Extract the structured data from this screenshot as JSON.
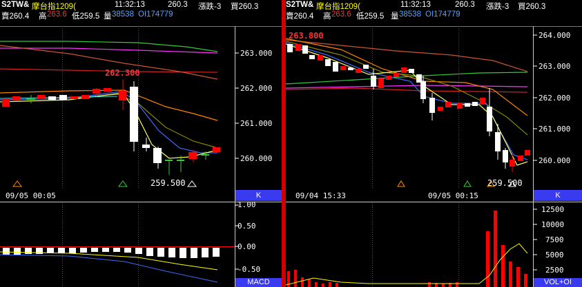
{
  "left": {
    "header": {
      "symbol": "S2TW&",
      "name": "摩台指1209(",
      "time": "11:32:13",
      "last": "260.3",
      "change": "漲跌-3",
      "bid_label": "買260.3",
      "ask": "賣260.4",
      "high_label": "高",
      "high": "263.6",
      "low": "低259.5",
      "volume_label": "量",
      "volume": "38538",
      "oi": "OI174779"
    },
    "price_axis": [
      "263.000",
      "262.000",
      "261.000",
      "260.000"
    ],
    "high_marker": "262.300",
    "low_marker": "259.500",
    "time_label": "09/05 00:05",
    "k_button": "K",
    "macd_axis": [
      "1.00",
      "0.50",
      "0.00",
      "-0.50"
    ],
    "macd_button": "MACD"
  },
  "right": {
    "header": {
      "symbol": "S2TW&",
      "name": "摩台指1209(",
      "time": "11:32:13",
      "last": "260.3",
      "change": "漲跌-3",
      "bid_label": "買260.3",
      "ask": "賣260.4",
      "high_label": "高",
      "high": "263.6",
      "low": "低259.5",
      "volume_label": "量",
      "volume": "38538",
      "oi": "OI174779"
    },
    "price_axis": [
      "264.000",
      "263.000",
      "262.000",
      "261.000",
      "260.000"
    ],
    "high_marker": "263.800",
    "low_marker": "259.500",
    "time_label_1": "09/04 15:33",
    "time_label_2": "09/05 00:15",
    "k_button": "K",
    "vol_axis": [
      "12500",
      "10000",
      "7500",
      "5000",
      "2500"
    ],
    "vol_button": "VOL+OI"
  },
  "colors": {
    "up": "#ff0000",
    "down": "#ffffff",
    "axis_yellow": "#ffff00",
    "button_blue": "#3a3af0",
    "divider": "#d00000"
  }
}
